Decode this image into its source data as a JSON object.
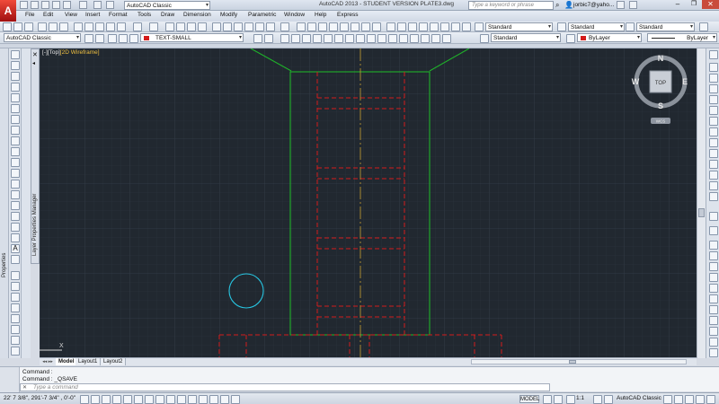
{
  "app": {
    "logo": "A",
    "title": "AutoCAD 2013 - STUDENT VERSION    PLATE3.dwg"
  },
  "titlebar": {
    "workspace": "AutoCAD Classic",
    "search_placeholder": "Type a keyword or phrase",
    "user": "jorbic7@yaho..."
  },
  "menu": [
    "File",
    "Edit",
    "View",
    "Insert",
    "Format",
    "Tools",
    "Draw",
    "Dimension",
    "Modify",
    "Parametric",
    "Window",
    "Help",
    "Express"
  ],
  "toolbar2": {
    "workspace": "AutoCAD Classic",
    "text_style_1": "Standard",
    "dim_style": "Standard",
    "table_style": "Standard"
  },
  "toolbar3": {
    "workspace": "AutoCAD Classic",
    "text_style": "TEXT-SMALL",
    "style_right": "Standard",
    "color": "ByLayer",
    "linetype": "ByLayer"
  },
  "palettes": {
    "properties": "Properties",
    "layer_manager": "Layer Properties Manager"
  },
  "viewport": {
    "prefix": "[-][Top]",
    "visual_style": "[2D Wireframe]"
  },
  "viewcube": {
    "n": "N",
    "s": "S",
    "e": "E",
    "w": "W",
    "top": "TOP",
    "wcs": "WCS"
  },
  "ucs": {
    "x": "X",
    "y": "Y"
  },
  "tabs": [
    "Model",
    "Layout1",
    "Layout2"
  ],
  "command": {
    "history": [
      "Command :",
      "Command :      _QSAVE"
    ],
    "placeholder": "Type a command"
  },
  "status": {
    "coords": "22' 7 3/8\",  291'-7 3/4\" , 0'-0\"",
    "model": "MODEL",
    "scale": "1:1",
    "workspace": "AutoCAD Classic"
  },
  "colors": {
    "canvas": "#212830",
    "green": "#1fb12a",
    "red": "#d41c1c",
    "cyan": "#27c4e0",
    "centerline": "#c8a030"
  }
}
